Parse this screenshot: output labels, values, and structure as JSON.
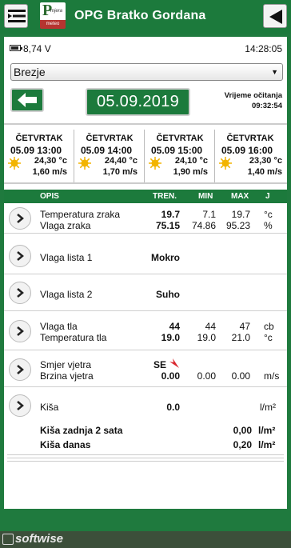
{
  "header": {
    "title": "OPG Bratko Gordana",
    "logo_letter": "P",
    "logo_sub": "mjera",
    "logo_bottom": "meteo"
  },
  "status": {
    "battery": "8,74 V",
    "time": "14:28:05"
  },
  "station_select": {
    "value": "Brezje"
  },
  "date_nav": {
    "date": "05.09.2019",
    "reading_label": "Vrijeme očitanja",
    "reading_time": "09:32:54"
  },
  "forecast": [
    {
      "day": "ČETVRTAK",
      "datetime": "05.09 13:00",
      "temp": "24,30 °c",
      "wind": "1,60 m/s",
      "icon": "sun-icon"
    },
    {
      "day": "ČETVRTAK",
      "datetime": "05.09 14:00",
      "temp": "24,40 °c",
      "wind": "1,70 m/s",
      "icon": "sun-icon"
    },
    {
      "day": "ČETVRTAK",
      "datetime": "05.09 15:00",
      "temp": "24,10 °c",
      "wind": "1,90 m/s",
      "icon": "sun-icon"
    },
    {
      "day": "ČETVRTAK",
      "datetime": "05.09 16:00",
      "temp": "23,30 °c",
      "wind": "1,40 m/s",
      "icon": "sun-icon"
    }
  ],
  "table_head": {
    "opis": "OPIS",
    "tren": "TREN.",
    "min": "MIN",
    "max": "MAX",
    "j": "J"
  },
  "rows": {
    "air": {
      "l1": "Temperatura zraka",
      "v1": "19.7",
      "min1": "7.1",
      "max1": "19.7",
      "u1": "°c",
      "l2": "Vlaga zraka",
      "v2": "75.15",
      "min2": "74.86",
      "max2": "95.23",
      "u2": "%"
    },
    "leaf1": {
      "l1": "Vlaga lista 1",
      "v1": "Mokro"
    },
    "leaf2": {
      "l1": "Vlaga lista 2",
      "v1": "Suho"
    },
    "soil": {
      "l1": "Vlaga tla",
      "v1": "44",
      "min1": "44",
      "max1": "47",
      "u1": "cb",
      "l2": "Temperatura tla",
      "v2": "19.0",
      "min2": "19.0",
      "max2": "21.0",
      "u2": "°c"
    },
    "wind": {
      "l1": "Smjer vjetra",
      "v1": "SE",
      "l2": "Brzina vjetra",
      "v2": "0.00",
      "min2": "0.00",
      "max2": "0.00",
      "u2": "m/s"
    },
    "rain": {
      "l1": "Kiša",
      "v1": "0.0",
      "u1": "l/m²"
    }
  },
  "rain_summary": {
    "l1": "Kiša zadnja 2 sata",
    "v1": "0,00",
    "u1": "l/m²",
    "l2": "Kiša danas",
    "v2": "0,20",
    "u2": "l/m²"
  },
  "footer": {
    "brand": "softwise"
  },
  "colors": {
    "primary": "#1c7a3c",
    "wind_arrow": "#d9262e",
    "sun": "#f2b400"
  }
}
